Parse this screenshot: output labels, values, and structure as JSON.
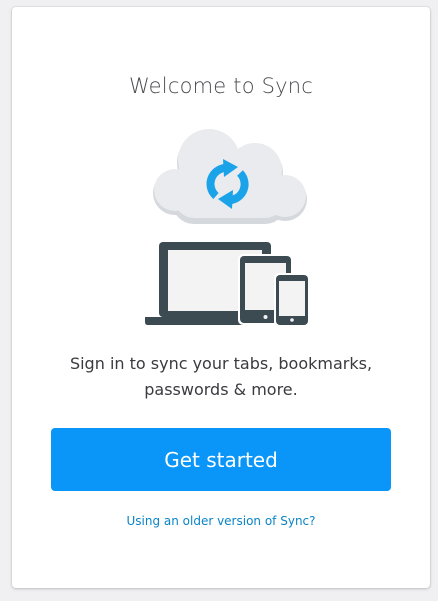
{
  "welcome": {
    "title": "Welcome to Sync",
    "description": "Sign in to sync your tabs, bookmarks, passwords & more.",
    "primary_button": "Get started",
    "secondary_link": "Using an older version of Sync?"
  },
  "icons": {
    "cloud": "cloud-sync-icon",
    "devices": "devices-icon"
  },
  "colors": {
    "accent": "#0996f8",
    "link": "#0a84c6",
    "sync_arrows": "#1aa3e8",
    "cloud": "#e2e4e7",
    "device_frame": "#3c4a52"
  }
}
